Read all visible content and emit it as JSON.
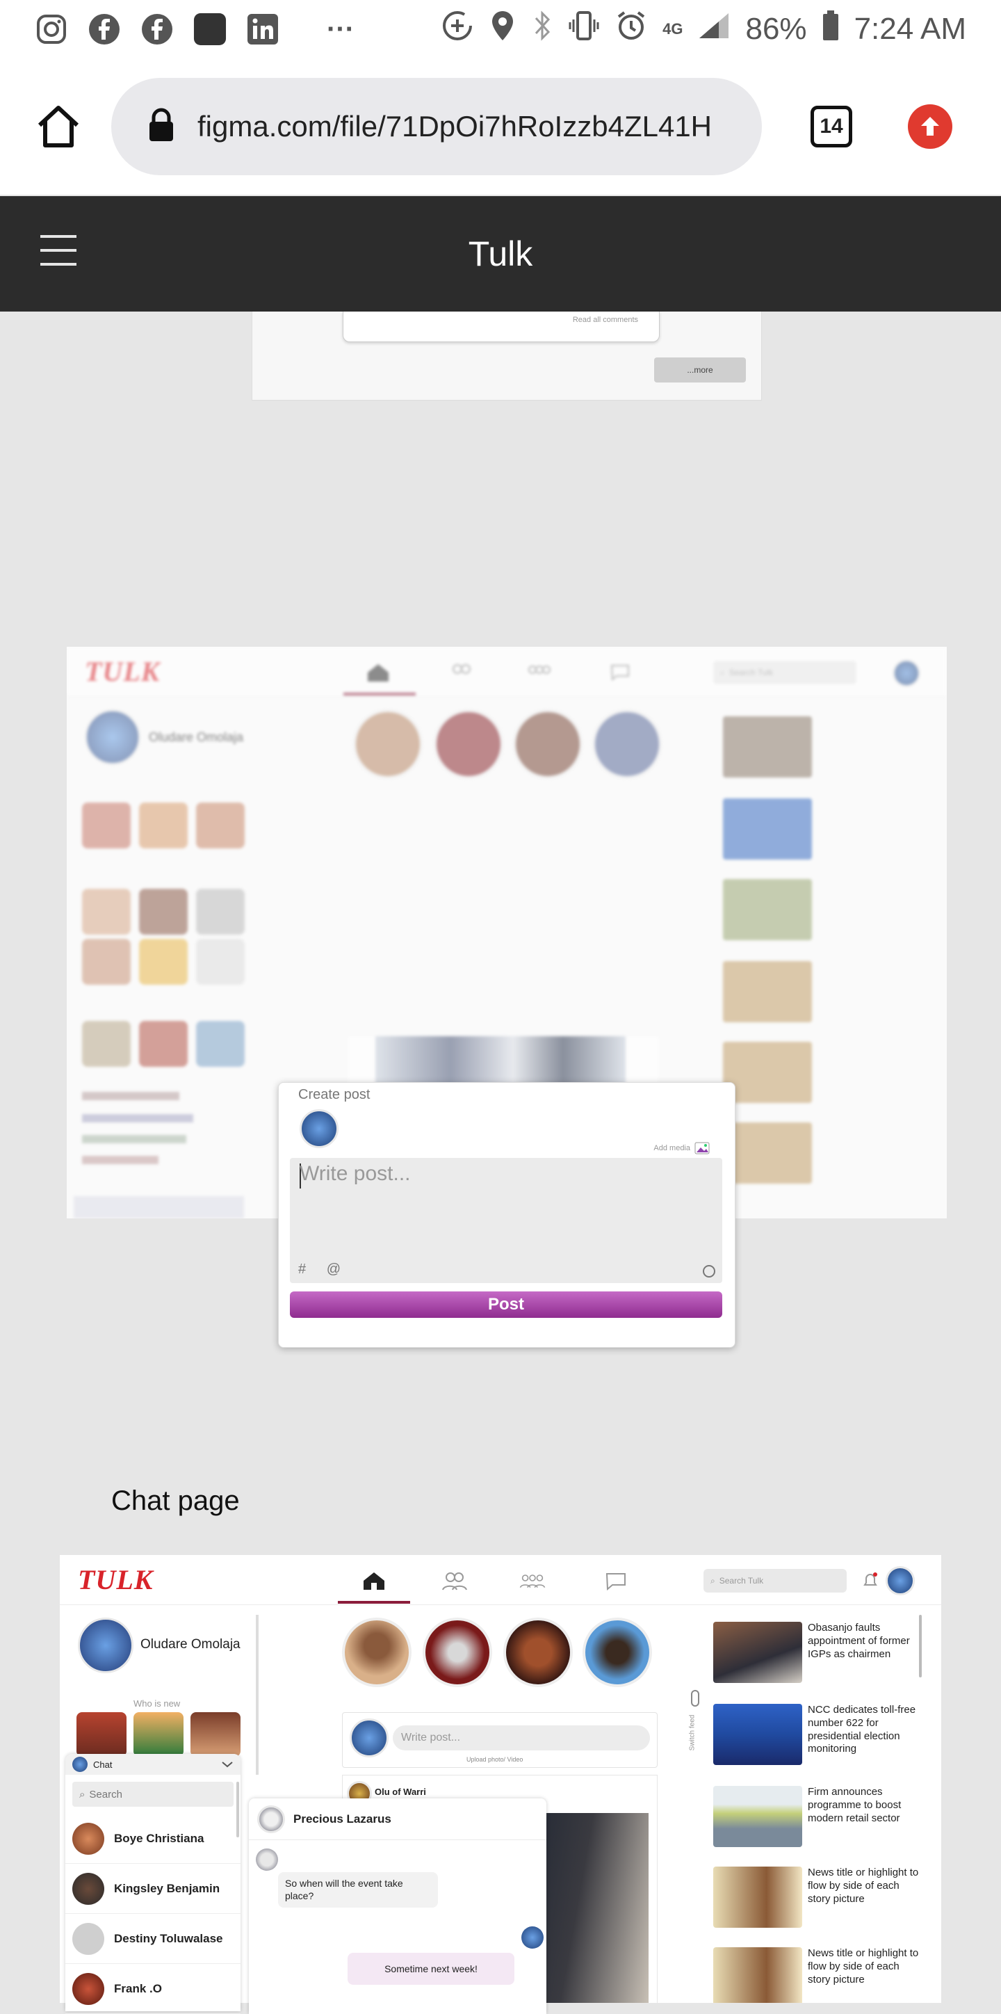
{
  "status_bar": {
    "battery": "86%",
    "time": "7:24 AM",
    "network": "4G",
    "more": "···"
  },
  "browser": {
    "url": "figma.com/file/71DpOi7hRoIzzb4ZL41H",
    "tab_count": "14"
  },
  "figma": {
    "title": "Tulk"
  },
  "top_fragment": {
    "read_all": "Read all comments",
    "more": "...more"
  },
  "frame1": {
    "logo": "TULK",
    "search_placeholder": "Search Tulk",
    "profile_name": "Oludare Omolaja",
    "modal": {
      "title": "Create post",
      "add_media": "Add media",
      "placeholder": "Write post...",
      "hash": "#",
      "at": "@",
      "post_button": "Post"
    }
  },
  "chat_section": {
    "label": "Chat page"
  },
  "frame2": {
    "logo": "TULK",
    "search_placeholder": "Search Tulk",
    "profile_name": "Oludare Omolaja",
    "who_is_new": "Who is new",
    "write_post_placeholder": "Write post...",
    "upload_line": "Upload photo/ Video",
    "post_author": "Olu of Warri",
    "switch_feed": "Switch feed",
    "news": [
      {
        "text": "Obasanjo faults appointment of former IGPs as chairmen"
      },
      {
        "text": "NCC dedicates toll-free number 622 for presidential election monitoring"
      },
      {
        "text": "Firm announces programme to boost modern retail sector"
      },
      {
        "text": "News title or highlight to flow by side of each story picture"
      },
      {
        "text": "News title or highlight to flow by side of each story picture"
      }
    ],
    "chat": {
      "header": "Chat",
      "search": "Search",
      "contacts": [
        {
          "name": "Boye Christiana"
        },
        {
          "name": "Kingsley Benjamin"
        },
        {
          "name": "Destiny Toluwalase"
        },
        {
          "name": "Frank .O"
        }
      ]
    },
    "conversation": {
      "name": "Precious Lazarus",
      "incoming": "So when will the event take place?",
      "outgoing": "Sometime next week!"
    }
  }
}
